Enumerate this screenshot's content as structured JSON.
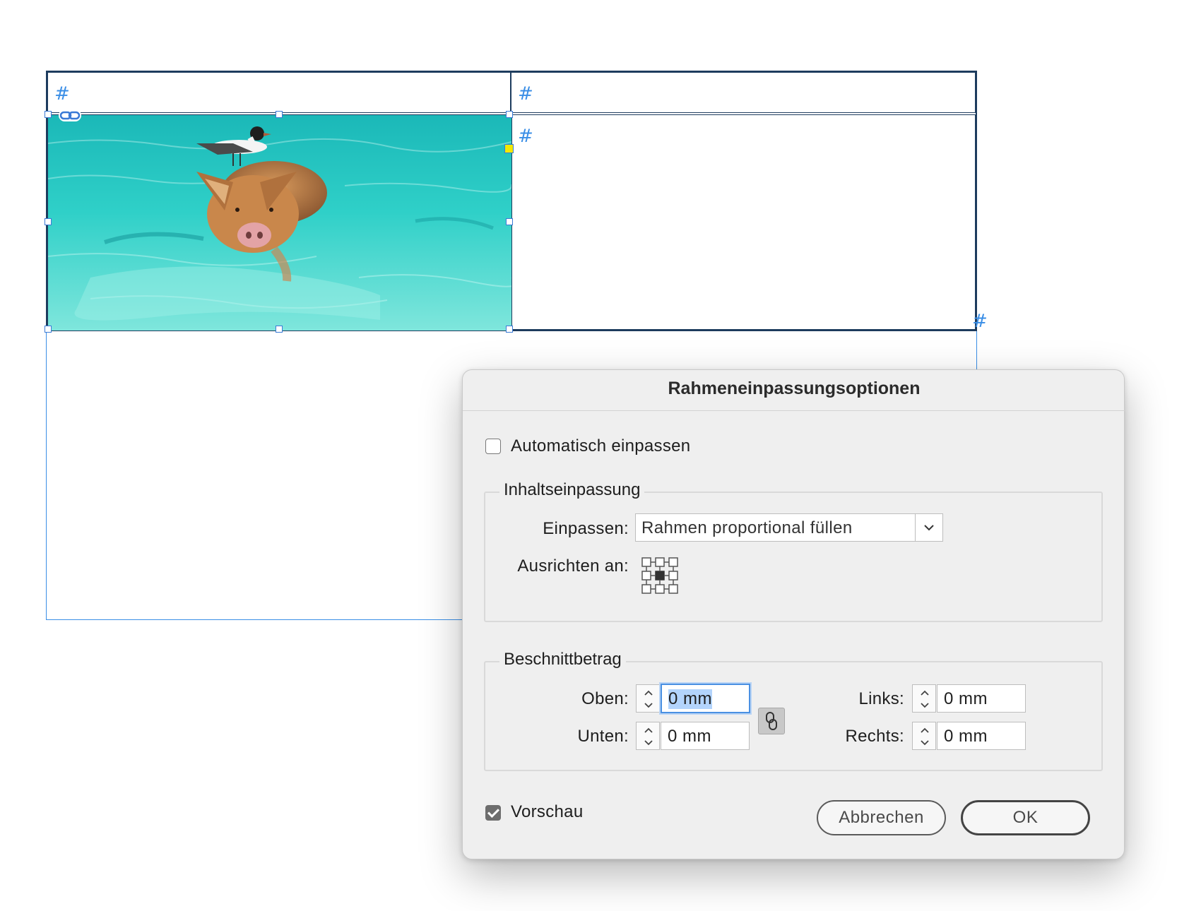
{
  "document": {
    "cell_marker": "#",
    "image_name": "swimming pig with seagull in turquoise water",
    "link_icon": "link-icon"
  },
  "dialog": {
    "title": "Rahmeneinpassungsoptionen",
    "auto_fit": {
      "label": "Automatisch einpassen",
      "checked": false
    },
    "content_fitting": {
      "legend": "Inhaltseinpassung",
      "fit_label": "Einpassen:",
      "fit_value": "Rahmen proportional füllen",
      "align_label": "Ausrichten an:",
      "align_selected": "center"
    },
    "crop_amount": {
      "legend": "Beschnittbetrag",
      "top_label": "Oben:",
      "top_value": "0 mm",
      "bottom_label": "Unten:",
      "bottom_value": "0 mm",
      "left_label": "Links:",
      "left_value": "0 mm",
      "right_label": "Rechts:",
      "right_value": "0 mm",
      "chain_icon": "chain-link-icon"
    },
    "preview": {
      "label": "Vorschau",
      "checked": true
    },
    "cancel_label": "Abbrechen",
    "ok_label": "OK"
  }
}
